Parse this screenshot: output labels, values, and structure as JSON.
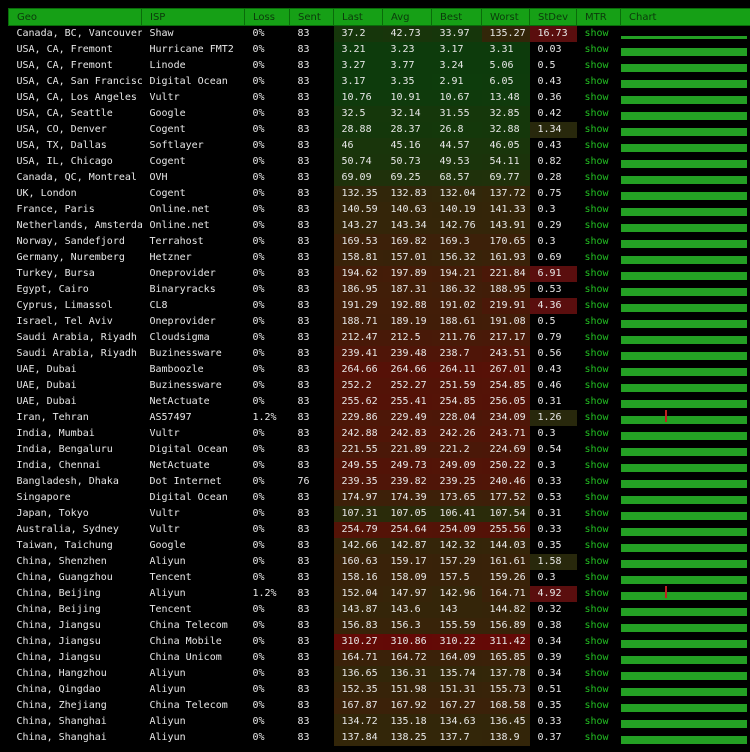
{
  "headers": [
    "Geo",
    "ISP",
    "Loss",
    "Sent",
    "Last",
    "Avg",
    "Best",
    "Worst",
    "StDev",
    "MTR",
    "Chart"
  ],
  "colors": {
    "header_bg": "#16a016",
    "show_link": "#22c022",
    "chart_bar": "#24a024",
    "chart_spike": "#c02020"
  },
  "rows": [
    {
      "geo": "Canada, BC, Vancouver",
      "isp": "Shaw",
      "loss": "0%",
      "sent": "83",
      "last": "37.2",
      "avg": "42.73",
      "best": "33.97",
      "worst": "135.27",
      "stdev": "16.73",
      "mtr": "show"
    },
    {
      "geo": "USA, CA, Fremont",
      "isp": "Hurricane FMT2",
      "loss": "0%",
      "sent": "83",
      "last": "3.21",
      "avg": "3.23",
      "best": "3.17",
      "worst": "3.31",
      "stdev": "0.03",
      "mtr": "show"
    },
    {
      "geo": "USA, CA, Fremont",
      "isp": "Linode",
      "loss": "0%",
      "sent": "83",
      "last": "3.27",
      "avg": "3.77",
      "best": "3.24",
      "worst": "5.06",
      "stdev": "0.5",
      "mtr": "show"
    },
    {
      "geo": "USA, CA, San Francisco",
      "isp": "Digital Ocean",
      "loss": "0%",
      "sent": "83",
      "last": "3.17",
      "avg": "3.35",
      "best": "2.91",
      "worst": "6.05",
      "stdev": "0.43",
      "mtr": "show"
    },
    {
      "geo": "USA, CA, Los Angeles",
      "isp": "Vultr",
      "loss": "0%",
      "sent": "83",
      "last": "10.76",
      "avg": "10.91",
      "best": "10.67",
      "worst": "13.48",
      "stdev": "0.36",
      "mtr": "show"
    },
    {
      "geo": "USA, CA, Seattle",
      "isp": "Google",
      "loss": "0%",
      "sent": "83",
      "last": "32.5",
      "avg": "32.14",
      "best": "31.55",
      "worst": "32.85",
      "stdev": "0.42",
      "mtr": "show"
    },
    {
      "geo": "USA, CO, Denver",
      "isp": "Cogent",
      "loss": "0%",
      "sent": "83",
      "last": "28.88",
      "avg": "28.37",
      "best": "26.8",
      "worst": "32.88",
      "stdev": "1.34",
      "mtr": "show"
    },
    {
      "geo": "USA, TX, Dallas",
      "isp": "Softlayer",
      "loss": "0%",
      "sent": "83",
      "last": "46",
      "avg": "45.16",
      "best": "44.57",
      "worst": "46.05",
      "stdev": "0.43",
      "mtr": "show"
    },
    {
      "geo": "USA, IL, Chicago",
      "isp": "Cogent",
      "loss": "0%",
      "sent": "83",
      "last": "50.74",
      "avg": "50.73",
      "best": "49.53",
      "worst": "54.11",
      "stdev": "0.82",
      "mtr": "show"
    },
    {
      "geo": "Canada, QC, Montreal",
      "isp": "OVH",
      "loss": "0%",
      "sent": "83",
      "last": "69.09",
      "avg": "69.25",
      "best": "68.57",
      "worst": "69.77",
      "stdev": "0.28",
      "mtr": "show"
    },
    {
      "geo": "UK, London",
      "isp": "Cogent",
      "loss": "0%",
      "sent": "83",
      "last": "132.35",
      "avg": "132.83",
      "best": "132.04",
      "worst": "137.72",
      "stdev": "0.75",
      "mtr": "show"
    },
    {
      "geo": "France, Paris",
      "isp": "Online.net",
      "loss": "0%",
      "sent": "83",
      "last": "140.59",
      "avg": "140.63",
      "best": "140.19",
      "worst": "141.33",
      "stdev": "0.3",
      "mtr": "show"
    },
    {
      "geo": "Netherlands, Amsterdam",
      "isp": "Online.net",
      "loss": "0%",
      "sent": "83",
      "last": "143.27",
      "avg": "143.34",
      "best": "142.76",
      "worst": "143.91",
      "stdev": "0.29",
      "mtr": "show"
    },
    {
      "geo": "Norway, Sandefjord",
      "isp": "Terrahost",
      "loss": "0%",
      "sent": "83",
      "last": "169.53",
      "avg": "169.82",
      "best": "169.3",
      "worst": "170.65",
      "stdev": "0.3",
      "mtr": "show"
    },
    {
      "geo": "Germany, Nuremberg",
      "isp": "Hetzner",
      "loss": "0%",
      "sent": "83",
      "last": "158.81",
      "avg": "157.01",
      "best": "156.32",
      "worst": "161.93",
      "stdev": "0.69",
      "mtr": "show"
    },
    {
      "geo": "Turkey, Bursa",
      "isp": "Oneprovider",
      "loss": "0%",
      "sent": "83",
      "last": "194.62",
      "avg": "197.89",
      "best": "194.21",
      "worst": "221.84",
      "stdev": "6.91",
      "mtr": "show"
    },
    {
      "geo": "Egypt, Cairo",
      "isp": "Binaryracks",
      "loss": "0%",
      "sent": "83",
      "last": "186.95",
      "avg": "187.31",
      "best": "186.32",
      "worst": "188.95",
      "stdev": "0.53",
      "mtr": "show"
    },
    {
      "geo": "Cyprus, Limassol",
      "isp": "CL8",
      "loss": "0%",
      "sent": "83",
      "last": "191.29",
      "avg": "192.88",
      "best": "191.02",
      "worst": "219.91",
      "stdev": "4.36",
      "mtr": "show"
    },
    {
      "geo": "Israel, Tel Aviv",
      "isp": "Oneprovider",
      "loss": "0%",
      "sent": "83",
      "last": "188.71",
      "avg": "189.19",
      "best": "188.61",
      "worst": "191.08",
      "stdev": "0.5",
      "mtr": "show"
    },
    {
      "geo": "Saudi Arabia, Riyadh",
      "isp": "Cloudsigma",
      "loss": "0%",
      "sent": "83",
      "last": "212.47",
      "avg": "212.5",
      "best": "211.76",
      "worst": "217.17",
      "stdev": "0.79",
      "mtr": "show"
    },
    {
      "geo": "Saudi Arabia, Riyadh",
      "isp": "Buzinessware",
      "loss": "0%",
      "sent": "83",
      "last": "239.41",
      "avg": "239.48",
      "best": "238.7",
      "worst": "243.51",
      "stdev": "0.56",
      "mtr": "show"
    },
    {
      "geo": "UAE, Dubai",
      "isp": "Bamboozle",
      "loss": "0%",
      "sent": "83",
      "last": "264.66",
      "avg": "264.66",
      "best": "264.11",
      "worst": "267.01",
      "stdev": "0.43",
      "mtr": "show"
    },
    {
      "geo": "UAE, Dubai",
      "isp": "Buzinessware",
      "loss": "0%",
      "sent": "83",
      "last": "252.2",
      "avg": "252.27",
      "best": "251.59",
      "worst": "254.85",
      "stdev": "0.46",
      "mtr": "show"
    },
    {
      "geo": "UAE, Dubai",
      "isp": "NetActuate",
      "loss": "0%",
      "sent": "83",
      "last": "255.62",
      "avg": "255.41",
      "best": "254.85",
      "worst": "256.05",
      "stdev": "0.31",
      "mtr": "show"
    },
    {
      "geo": "Iran, Tehran",
      "isp": "AS57497",
      "loss": "1.2%",
      "sent": "83",
      "last": "229.86",
      "avg": "229.49",
      "best": "228.04",
      "worst": "234.09",
      "stdev": "1.26",
      "mtr": "show",
      "spike": true
    },
    {
      "geo": "India, Mumbai",
      "isp": "Vultr",
      "loss": "0%",
      "sent": "83",
      "last": "242.88",
      "avg": "242.83",
      "best": "242.26",
      "worst": "243.71",
      "stdev": "0.3",
      "mtr": "show"
    },
    {
      "geo": "India, Bengaluru",
      "isp": "Digital Ocean",
      "loss": "0%",
      "sent": "83",
      "last": "221.55",
      "avg": "221.89",
      "best": "221.2",
      "worst": "224.69",
      "stdev": "0.54",
      "mtr": "show"
    },
    {
      "geo": "India, Chennai",
      "isp": "NetActuate",
      "loss": "0%",
      "sent": "83",
      "last": "249.55",
      "avg": "249.73",
      "best": "249.09",
      "worst": "250.22",
      "stdev": "0.3",
      "mtr": "show"
    },
    {
      "geo": "Bangladesh, Dhaka",
      "isp": "Dot Internet",
      "loss": "0%",
      "sent": "76",
      "last": "239.35",
      "avg": "239.82",
      "best": "239.25",
      "worst": "240.46",
      "stdev": "0.33",
      "mtr": "show"
    },
    {
      "geo": "Singapore",
      "isp": "Digital Ocean",
      "loss": "0%",
      "sent": "83",
      "last": "174.97",
      "avg": "174.39",
      "best": "173.65",
      "worst": "177.52",
      "stdev": "0.53",
      "mtr": "show"
    },
    {
      "geo": "Japan, Tokyo",
      "isp": "Vultr",
      "loss": "0%",
      "sent": "83",
      "last": "107.31",
      "avg": "107.05",
      "best": "106.41",
      "worst": "107.54",
      "stdev": "0.31",
      "mtr": "show"
    },
    {
      "geo": "Australia, Sydney",
      "isp": "Vultr",
      "loss": "0%",
      "sent": "83",
      "last": "254.79",
      "avg": "254.64",
      "best": "254.09",
      "worst": "255.56",
      "stdev": "0.33",
      "mtr": "show"
    },
    {
      "geo": "Taiwan, Taichung",
      "isp": "Google",
      "loss": "0%",
      "sent": "83",
      "last": "142.66",
      "avg": "142.87",
      "best": "142.32",
      "worst": "144.03",
      "stdev": "0.35",
      "mtr": "show"
    },
    {
      "geo": "China, Shenzhen",
      "isp": "Aliyun",
      "loss": "0%",
      "sent": "83",
      "last": "160.63",
      "avg": "159.17",
      "best": "157.29",
      "worst": "161.61",
      "stdev": "1.58",
      "mtr": "show"
    },
    {
      "geo": "China, Guangzhou",
      "isp": "Tencent",
      "loss": "0%",
      "sent": "83",
      "last": "158.16",
      "avg": "158.09",
      "best": "157.5",
      "worst": "159.26",
      "stdev": "0.3",
      "mtr": "show"
    },
    {
      "geo": "China, Beijing",
      "isp": "Aliyun",
      "loss": "1.2%",
      "sent": "83",
      "last": "152.04",
      "avg": "147.97",
      "best": "142.96",
      "worst": "164.71",
      "stdev": "4.92",
      "mtr": "show",
      "spike": true
    },
    {
      "geo": "China, Beijing",
      "isp": "Tencent",
      "loss": "0%",
      "sent": "83",
      "last": "143.87",
      "avg": "143.6",
      "best": "143",
      "worst": "144.82",
      "stdev": "0.32",
      "mtr": "show"
    },
    {
      "geo": "China, Jiangsu",
      "isp": "China Telecom",
      "loss": "0%",
      "sent": "83",
      "last": "156.83",
      "avg": "156.3",
      "best": "155.59",
      "worst": "156.89",
      "stdev": "0.38",
      "mtr": "show"
    },
    {
      "geo": "China, Jiangsu",
      "isp": "China Mobile",
      "loss": "0%",
      "sent": "83",
      "last": "310.27",
      "avg": "310.86",
      "best": "310.22",
      "worst": "311.42",
      "stdev": "0.34",
      "mtr": "show"
    },
    {
      "geo": "China, Jiangsu",
      "isp": "China Unicom",
      "loss": "0%",
      "sent": "83",
      "last": "164.71",
      "avg": "164.72",
      "best": "164.09",
      "worst": "165.85",
      "stdev": "0.39",
      "mtr": "show"
    },
    {
      "geo": "China, Hangzhou",
      "isp": "Aliyun",
      "loss": "0%",
      "sent": "83",
      "last": "136.65",
      "avg": "136.31",
      "best": "135.74",
      "worst": "137.78",
      "stdev": "0.34",
      "mtr": "show"
    },
    {
      "geo": "China, Qingdao",
      "isp": "Aliyun",
      "loss": "0%",
      "sent": "83",
      "last": "152.35",
      "avg": "151.98",
      "best": "151.31",
      "worst": "155.73",
      "stdev": "0.51",
      "mtr": "show"
    },
    {
      "geo": "China, Zhejiang",
      "isp": "China Telecom",
      "loss": "0%",
      "sent": "83",
      "last": "167.87",
      "avg": "167.92",
      "best": "167.27",
      "worst": "168.58",
      "stdev": "0.35",
      "mtr": "show"
    },
    {
      "geo": "China, Shanghai",
      "isp": "Aliyun",
      "loss": "0%",
      "sent": "83",
      "last": "134.72",
      "avg": "135.18",
      "best": "134.63",
      "worst": "136.45",
      "stdev": "0.33",
      "mtr": "show"
    },
    {
      "geo": "China, Shanghai",
      "isp": "Aliyun",
      "loss": "0%",
      "sent": "83",
      "last": "137.84",
      "avg": "138.25",
      "best": "137.7",
      "worst": "138.9",
      "stdev": "0.37",
      "mtr": "show"
    }
  ]
}
